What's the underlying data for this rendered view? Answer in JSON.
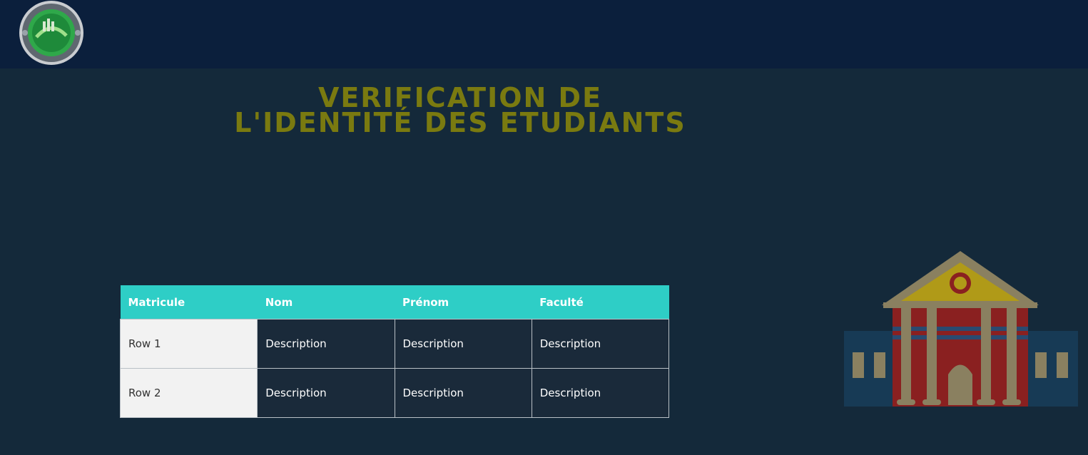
{
  "header": {
    "logo_icon": "university-seal-logo"
  },
  "title": {
    "line1": "VERIFICATION DE",
    "line2": "L'IDENTITÉ DES ETUDIANTS",
    "color": "#7a7a10"
  },
  "table": {
    "columns": [
      "Matricule",
      "Nom",
      "Prénom",
      "Faculté"
    ],
    "rows": [
      [
        "Row 1",
        "Description",
        "Description",
        "Description"
      ],
      [
        "Row 2",
        "Description",
        "Description",
        "Description"
      ]
    ],
    "header_color": "#2ecec6"
  },
  "illustration": {
    "icon": "university-building-icon"
  }
}
